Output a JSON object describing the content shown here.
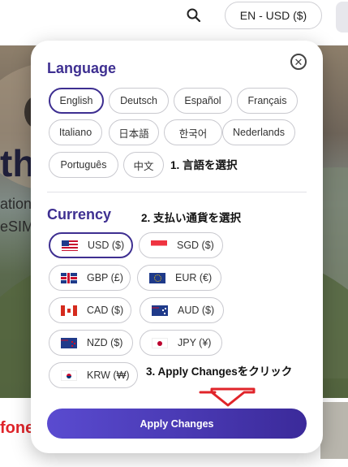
{
  "header": {
    "language_currency": "EN - USD ($)"
  },
  "background": {
    "hero_title": "th",
    "hero_sub1": "ation",
    "hero_sub2": "eSIM",
    "brand_partial": "fone"
  },
  "modal": {
    "language_title": "Language",
    "languages": [
      {
        "label": "English",
        "selected": true
      },
      {
        "label": "Deutsch"
      },
      {
        "label": "Español"
      },
      {
        "label": "Français"
      },
      {
        "label": "Italiano"
      },
      {
        "label": "日本語"
      },
      {
        "label": "한국어"
      },
      {
        "label": "Nederlands"
      },
      {
        "label": "Português"
      },
      {
        "label": "中文"
      }
    ],
    "currency_title": "Currency",
    "currencies": [
      {
        "label": "USD ($)",
        "flag": "us-flag-icon",
        "selected": true
      },
      {
        "label": "SGD ($)",
        "flag": "sg-flag-icon"
      },
      {
        "label": "GBP (£)",
        "flag": "gb-flag-icon"
      },
      {
        "label": "EUR (€)",
        "flag": "eu-flag-icon"
      },
      {
        "label": "CAD ($)",
        "flag": "ca-flag-icon"
      },
      {
        "label": "AUD ($)",
        "flag": "au-flag-icon"
      },
      {
        "label": "NZD ($)",
        "flag": "nz-flag-icon"
      },
      {
        "label": "JPY (¥)",
        "flag": "jp-flag-icon"
      },
      {
        "label": "KRW (₩)",
        "flag": "kr-flag-icon"
      }
    ],
    "apply_label": "Apply Changes"
  },
  "annotations": {
    "step1": "1. 言語を選択",
    "step2": "2. 支払い通貨を選択",
    "step3": "3. Apply Changesをクリック"
  },
  "colors": {
    "accent": "#3e2f91",
    "annotation_arrow": "#e0242a"
  }
}
